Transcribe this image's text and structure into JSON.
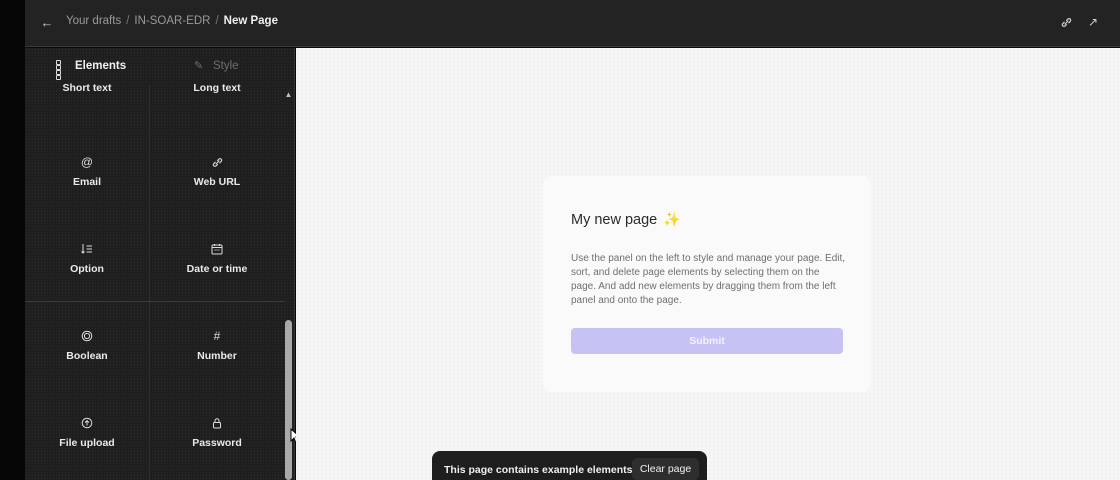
{
  "header": {
    "back_icon": "arrow-left-icon",
    "breadcrumb": [
      "Your drafts",
      "IN-SOAR-EDR",
      "New Page"
    ],
    "separator": "/",
    "actions": [
      {
        "icon": "link-icon"
      },
      {
        "icon": "external-link-icon"
      }
    ]
  },
  "panel": {
    "tabs": [
      {
        "label": "Elements",
        "icon": "grid-icon",
        "active": true
      },
      {
        "label": "Style",
        "icon": "brush-icon",
        "active": false
      }
    ],
    "elements": [
      {
        "label": "Short text",
        "icon": "text-icon"
      },
      {
        "label": "Long text",
        "icon": "paragraph-icon"
      },
      {
        "label": "Email",
        "icon": "at-icon",
        "glyph": "@"
      },
      {
        "label": "Web URL",
        "icon": "link-icon",
        "glyph": "⛓"
      },
      {
        "label": "Option",
        "icon": "list-icon",
        "glyph": "↓≡"
      },
      {
        "label": "Date or time",
        "icon": "calendar-icon",
        "glyph": "▦"
      },
      {
        "label": "Boolean",
        "icon": "toggle-circle-icon",
        "glyph": "◎"
      },
      {
        "label": "Number",
        "icon": "hash-icon",
        "glyph": "#"
      },
      {
        "label": "File upload",
        "icon": "upload-icon",
        "glyph": "⊕"
      },
      {
        "label": "Password",
        "icon": "lock-icon",
        "glyph": "🔒"
      }
    ]
  },
  "card": {
    "title": "My new page",
    "title_icon": "sparkle-icon",
    "description": "Use the panel on the left to style and manage your page. Edit, sort, and delete page elements by selecting them on the page. And add new elements by dragging them from the left panel and onto the page.",
    "submit_label": "Submit"
  },
  "toast": {
    "message": "This page contains example elements",
    "action_label": "Clear page"
  },
  "colors": {
    "accent": "#c6c3f4",
    "panel_bg": "#1f1f1f",
    "canvas_bg": "#f6f6f6"
  }
}
